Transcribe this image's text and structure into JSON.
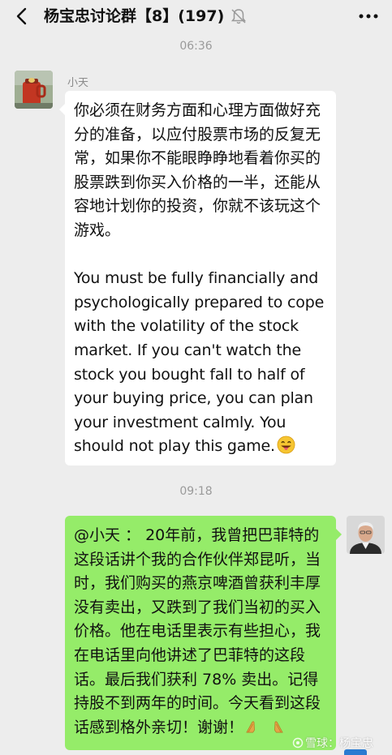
{
  "header": {
    "title": "杨宝忠讨论群【8】(197)",
    "back_icon": "chevron-left-icon",
    "mute_icon": "bell-off-icon",
    "more_icon": "more-dots-icon"
  },
  "messages": [
    {
      "timestamp": "06:36",
      "sender": "小天",
      "side": "left",
      "text_zh": "你必须在财务方面和心理方面做好充分的准备，以应付股票市场的反复无常，如果你不能眼睁睁地看着你买的股票跌到你买入价格的一半，还能从容地计划你的投资，你就不该玩这个游戏。",
      "text_en": "You must be fully financially and psychologically prepared to cope with the volatility of the stock market. If you can't watch the stock you bought fall to half of your buying price, you can plan your investment calmly. You should not play this game.",
      "emoji": "grinning-tongue-emoji"
    },
    {
      "timestamp": "09:18",
      "side": "right",
      "text": "@小天 ： 20年前，我曾把巴菲特的这段话讲个我的合作伙伴郑昆听，当时，我们购买的燕京啤酒曾获利丰厚没有卖出，又跌到了我们当初的买入价格。他在电话里表示有些担心，我在电话里向他讲述了巴菲特的这段话。最后我们获利 78% 卖出。记得持股不到两年的时间。今天看到这段话感到格外亲切！谢谢！",
      "emoji": "praying-hands-emoji"
    }
  ],
  "watermark": "雪球：杨宝忠",
  "colors": {
    "background": "#ededed",
    "bubble_self": "#95ec69",
    "bubble_other": "#ffffff"
  }
}
